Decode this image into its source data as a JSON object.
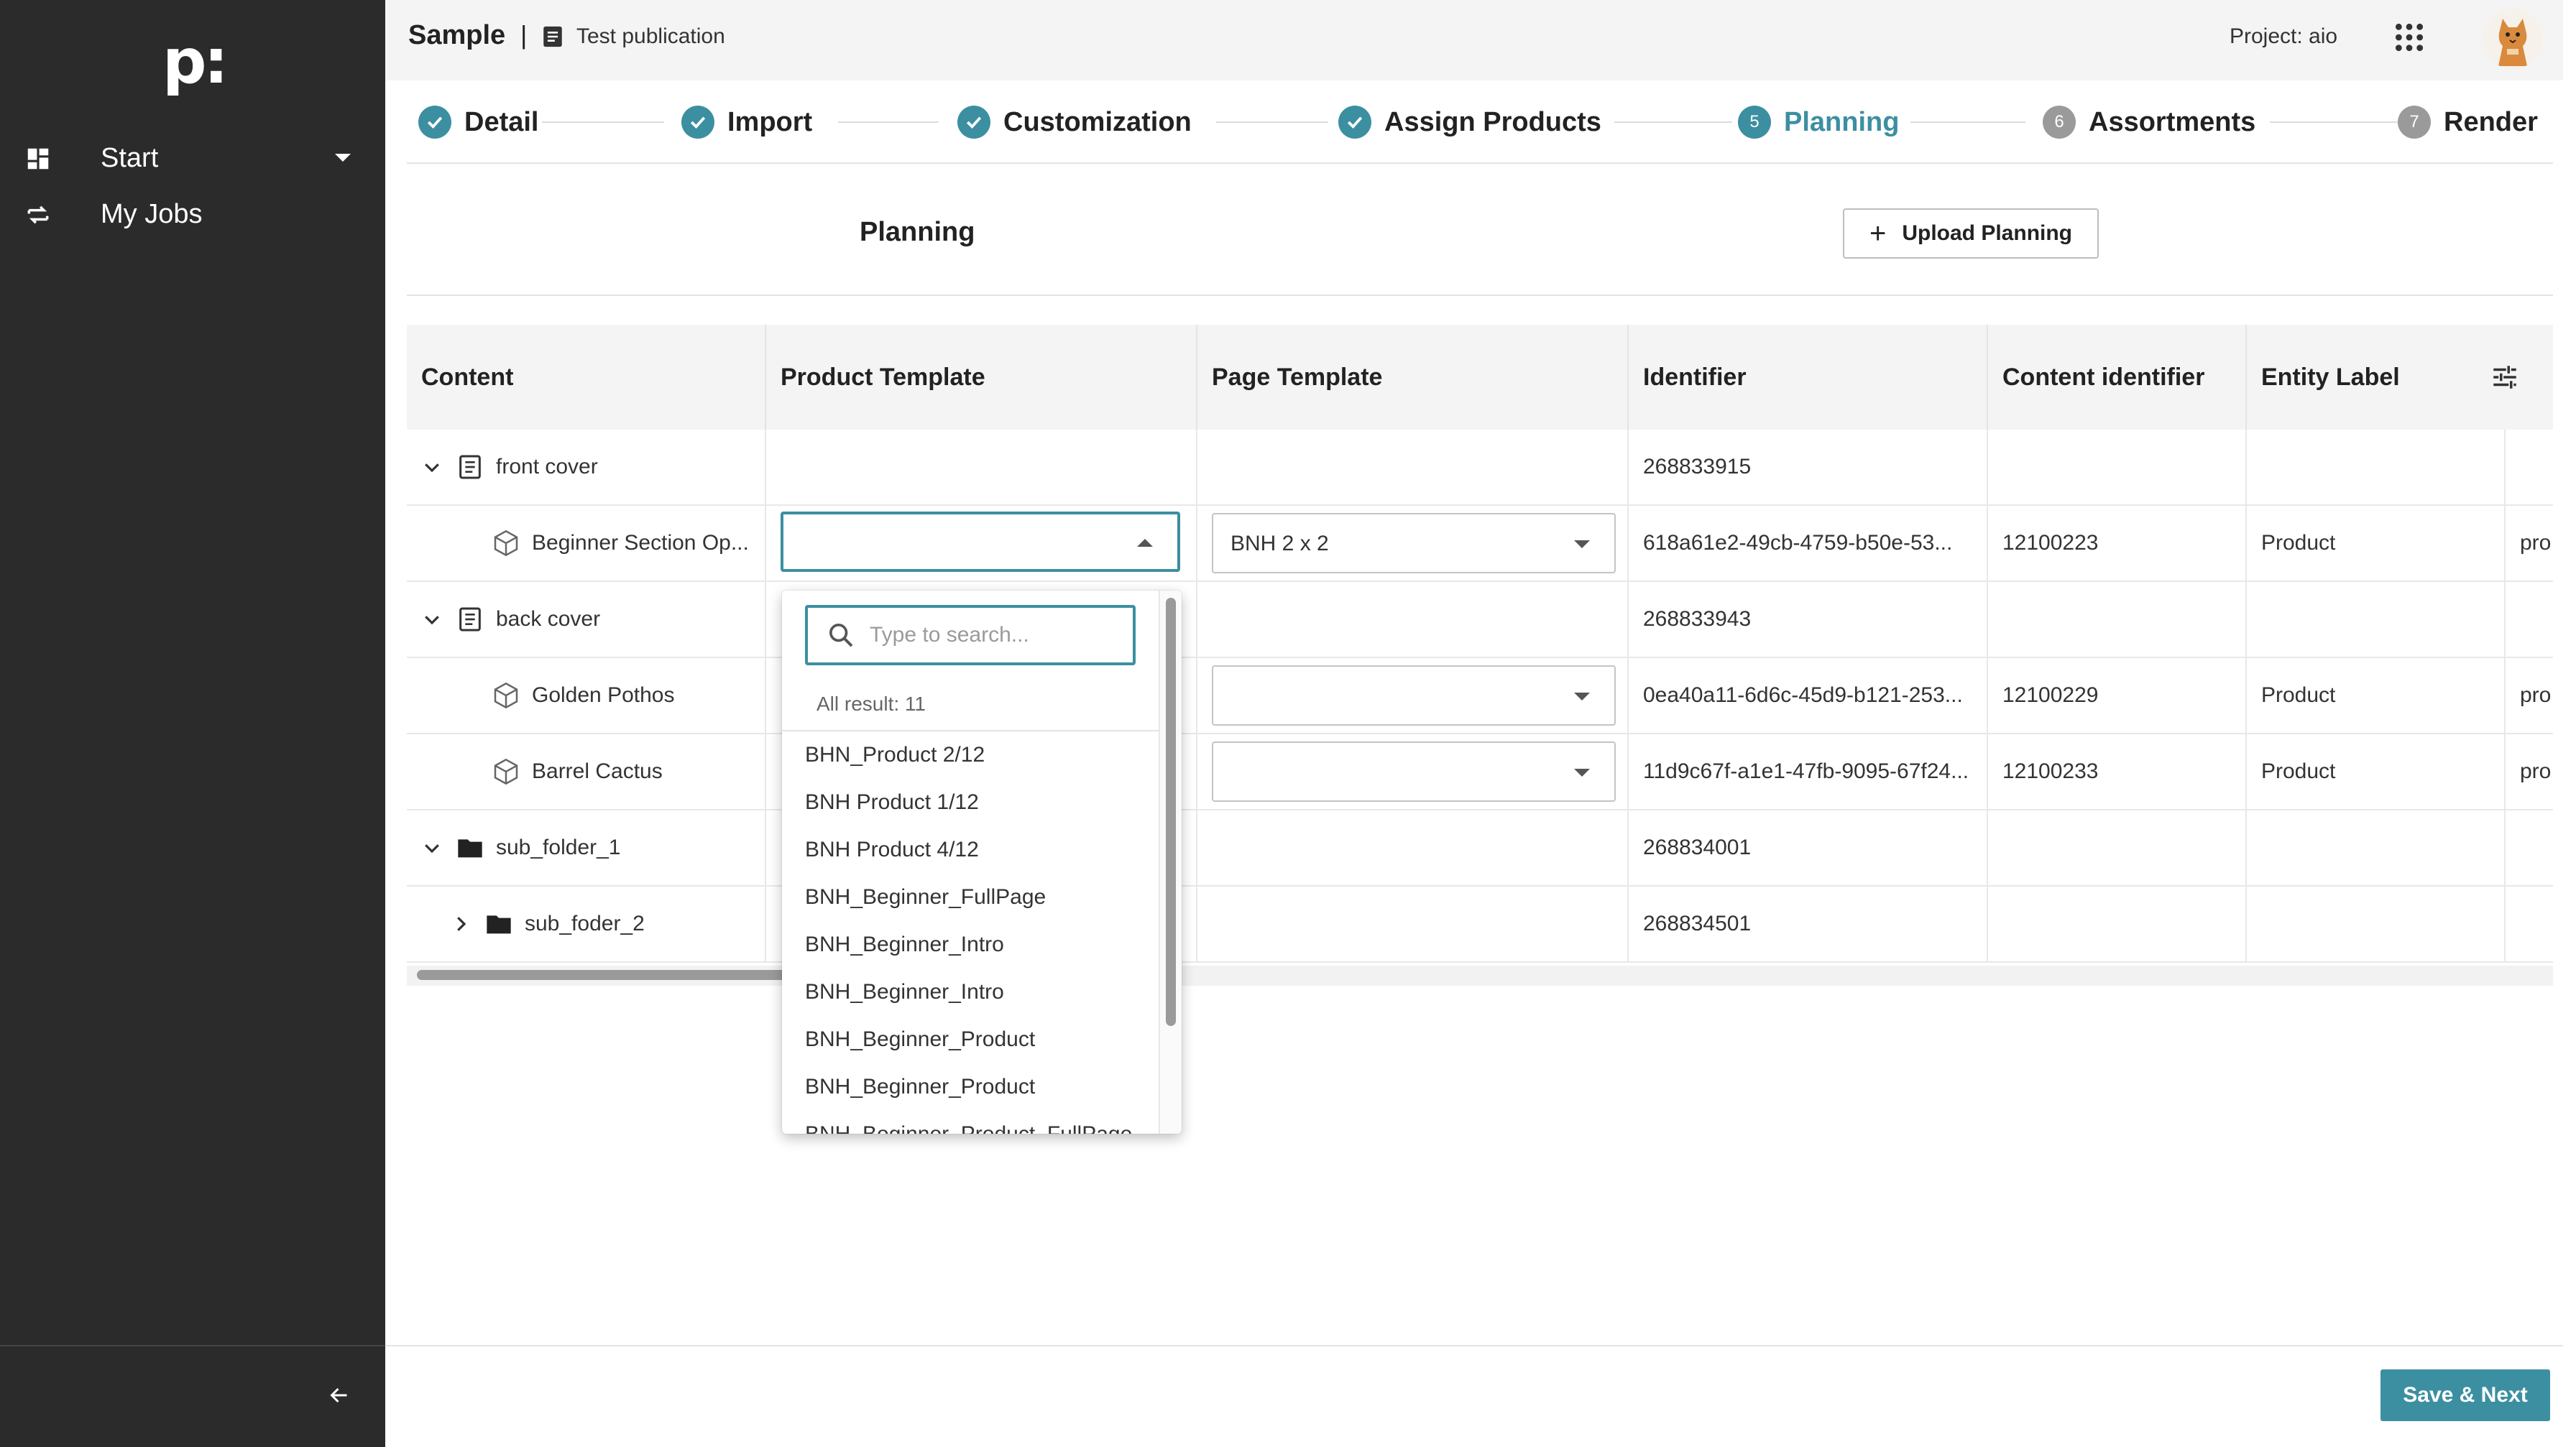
{
  "sidebar": {
    "logo_text": "p:",
    "items": [
      {
        "label": "Start",
        "icon": "dashboard-icon"
      },
      {
        "label": "My Jobs",
        "icon": "swap-icon"
      }
    ],
    "collapse_icon": "arrow-left-icon"
  },
  "header": {
    "app_title": "Sample",
    "separator": "|",
    "publication_icon": "document-icon",
    "publication_name": "Test publication",
    "project_label": "Project: aio",
    "apps_icon": "grid-dots-icon",
    "avatar": "cat-avatar"
  },
  "stepper": {
    "steps": [
      {
        "number": "1",
        "label": "Detail",
        "state": "done"
      },
      {
        "number": "2",
        "label": "Import",
        "state": "done"
      },
      {
        "number": "3",
        "label": "Customization",
        "state": "done"
      },
      {
        "number": "4",
        "label": "Assign Products",
        "state": "done"
      },
      {
        "number": "5",
        "label": "Planning",
        "state": "active"
      },
      {
        "number": "6",
        "label": "Assortments",
        "state": "todo"
      },
      {
        "number": "7",
        "label": "Render",
        "state": "todo"
      }
    ]
  },
  "planning": {
    "title": "Planning",
    "upload_button": "Upload Planning"
  },
  "table": {
    "columns": [
      "Content",
      "Product Template",
      "Page Template",
      "Identifier",
      "Content identifier",
      "Entity Label"
    ],
    "settings_icon": "tune-icon",
    "rows": [
      {
        "content": "front cover",
        "type": "page",
        "expand": "expanded",
        "product_template": "",
        "page_template": "",
        "identifier": "268833915",
        "content_identifier": "",
        "entity_label": "",
        "extra": ""
      },
      {
        "content": "Beginner Section Op...",
        "type": "product",
        "expand": "",
        "product_template": "",
        "page_template": "BNH 2 x 2",
        "identifier": "618a61e2-49cb-4759-b50e-53...",
        "content_identifier": "12100223",
        "entity_label": "Product",
        "extra": "pro"
      },
      {
        "content": "back cover",
        "type": "page",
        "expand": "expanded",
        "product_template": "",
        "page_template": "",
        "identifier": "268833943",
        "content_identifier": "",
        "entity_label": "",
        "extra": ""
      },
      {
        "content": "Golden Pothos",
        "type": "product",
        "expand": "",
        "product_template": "",
        "page_template": "",
        "identifier": "0ea40a11-6d6c-45d9-b121-253...",
        "content_identifier": "12100229",
        "entity_label": "Product",
        "extra": "pro"
      },
      {
        "content": "Barrel Cactus",
        "type": "product",
        "expand": "",
        "product_template": "",
        "page_template": "",
        "identifier": "11d9c67f-a1e1-47fb-9095-67f24...",
        "content_identifier": "12100233",
        "entity_label": "Product",
        "extra": "pro"
      },
      {
        "content": "sub_folder_1",
        "type": "folder",
        "expand": "expanded",
        "product_template": "",
        "page_template": "",
        "identifier": "268834001",
        "content_identifier": "",
        "entity_label": "",
        "extra": ""
      },
      {
        "content": "sub_foder_2",
        "type": "folder",
        "expand": "collapsed",
        "product_template": "",
        "page_template": "",
        "identifier": "268834501",
        "content_identifier": "",
        "entity_label": "",
        "extra": ""
      }
    ]
  },
  "dropdown": {
    "search_placeholder": "Type to search...",
    "result_count": "All result: 11",
    "options": [
      "BHN_Product 2/12",
      "BNH Product 1/12",
      "BNH Product 4/12",
      "BNH_Beginner_FullPage",
      "BNH_Beginner_Intro",
      "BNH_Beginner_Intro",
      "BNH_Beginner_Product",
      "BNH_Beginner_Product",
      "BNH_Beginner_Product_FullPage"
    ]
  },
  "footer": {
    "save_button": "Save & Next"
  },
  "colors": {
    "accent": "#3c8fa1",
    "sidebar": "#2b2b2b",
    "pending_step": "#9a9a9a"
  }
}
